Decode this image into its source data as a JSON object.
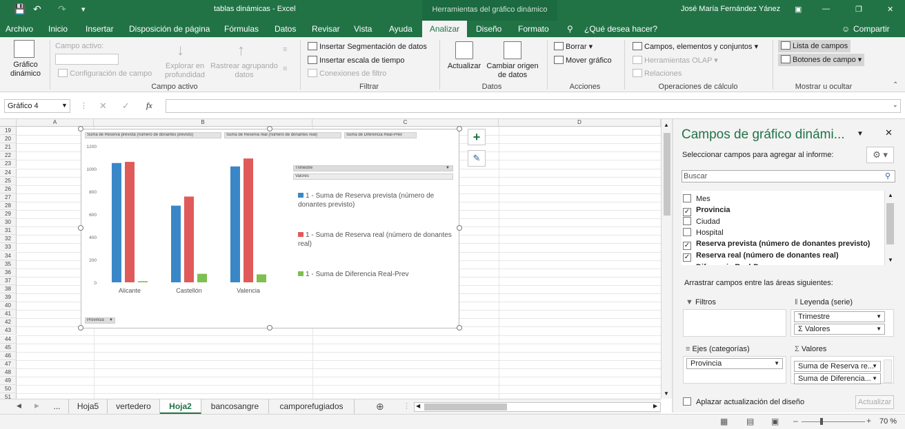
{
  "titlebar": {
    "filename": "tablas dinámicas  -  Excel",
    "context_tab": "Herramientas del gráfico dinámico",
    "user": "José María Fernández Yánez"
  },
  "menu_tabs": [
    "Archivo",
    "Inicio",
    "Insertar",
    "Disposición de página",
    "Fórmulas",
    "Datos",
    "Revisar",
    "Vista",
    "Ayuda",
    "Analizar",
    "Diseño",
    "Formato"
  ],
  "menu_active": "Analizar",
  "tell_me": "¿Qué desea hacer?",
  "share": "Compartir",
  "ribbon": {
    "grafico_dinamico": "Gráfico dinámico",
    "campo_activo_label": "Campo activo:",
    "configuracion_campo": "Configuración de campo",
    "explorar": "Explorar en profundidad",
    "rastrear": "Rastrear agrupando datos",
    "group_campo_activo": "Campo activo",
    "insertar_segmentacion": "Insertar Segmentación de datos",
    "insertar_escala": "Insertar escala de tiempo",
    "conexiones_filtro": "Conexiones de filtro",
    "group_filtrar": "Filtrar",
    "actualizar": "Actualizar",
    "cambiar_origen": "Cambiar origen de datos",
    "group_datos": "Datos",
    "borrar": "Borrar",
    "mover_grafico": "Mover gráfico",
    "group_acciones": "Acciones",
    "campos_elementos": "Campos, elementos y conjuntos",
    "herramientas_olap": "Herramientas OLAP",
    "relaciones": "Relaciones",
    "group_operaciones": "Operaciones de cálculo",
    "lista_campos": "Lista de campos",
    "botones_campo": "Botones de campo",
    "group_mostrar": "Mostrar u ocultar"
  },
  "formula": {
    "namebox": "Gráfico 4",
    "fx": "fx"
  },
  "columns": [
    "A",
    "B",
    "C",
    "D"
  ],
  "rows": [
    "19",
    "20",
    "21",
    "22",
    "23",
    "24",
    "25",
    "26",
    "27",
    "28",
    "29",
    "30",
    "31",
    "32",
    "33",
    "34",
    "35",
    "36",
    "37",
    "38",
    "39",
    "40",
    "41",
    "42",
    "43",
    "44",
    "45",
    "46",
    "47",
    "48",
    "49",
    "50",
    "51"
  ],
  "chart": {
    "value_buttons": [
      "Suma de Reserva prevista (número de donantes previsto)",
      "Suma de Reserva real (número de donantes real)",
      "Suma de Diferencia Real-Prev"
    ],
    "legend_button": "Trimestre",
    "legend_values": "Valores",
    "axis_button": "Provincia"
  },
  "chart_data": {
    "type": "bar",
    "categories": [
      "Alicante",
      "Castellón",
      "Valencia"
    ],
    "series": [
      {
        "name": "1 - Suma de Reserva prevista (número de donantes previsto)",
        "color": "#3a87c8",
        "values": [
          1050,
          675,
          1020
        ]
      },
      {
        "name": "1 - Suma de Reserva real (número de donantes real)",
        "color": "#e05a5a",
        "values": [
          1060,
          755,
          1090
        ]
      },
      {
        "name": "1 - Suma de Diferencia Real-Prev",
        "color": "#7ebf4f",
        "values": [
          10,
          75,
          70
        ]
      }
    ],
    "ylim": [
      0,
      1200
    ],
    "yticks": [
      "0",
      "200",
      "400",
      "600",
      "800",
      "1000",
      "1200"
    ],
    "grid": false,
    "legend_placement": "right"
  },
  "panel": {
    "title": "Campos de gráfico dinámi...",
    "subtitle": "Seleccionar campos para agregar al informe:",
    "search_placeholder": "Buscar",
    "fields": [
      {
        "label": "Mes",
        "checked": false,
        "bold": false
      },
      {
        "label": "Provincia",
        "checked": true,
        "bold": true
      },
      {
        "label": "Ciudad",
        "checked": false,
        "bold": false
      },
      {
        "label": "Hospital",
        "checked": false,
        "bold": false
      },
      {
        "label": "Reserva prevista (número de donantes previsto)",
        "checked": true,
        "bold": true
      },
      {
        "label": "Reserva real (número de donantes real)",
        "checked": true,
        "bold": true
      },
      {
        "label": "Diferencia Real-Prev",
        "checked": true,
        "bold": true
      }
    ],
    "drag_text": "Arrastrar campos entre las áreas siguientes:",
    "filtros": "Filtros",
    "leyenda": "Leyenda (serie)",
    "leyenda_items": [
      "Trimestre",
      "Σ  Valores"
    ],
    "ejes": "Ejes (categorías)",
    "ejes_items": [
      "Provincia"
    ],
    "valores": "Valores",
    "valores_items": [
      "Suma de Reserva re...",
      "Suma de Diferencia..."
    ],
    "defer": "Aplazar actualización del diseño",
    "update": "Actualizar"
  },
  "sheets": [
    "...",
    "Hoja5",
    "vertedero",
    "Hoja2",
    "bancosangre",
    "camporefugiados"
  ],
  "active_sheet": "Hoja2",
  "zoom": "70 %"
}
